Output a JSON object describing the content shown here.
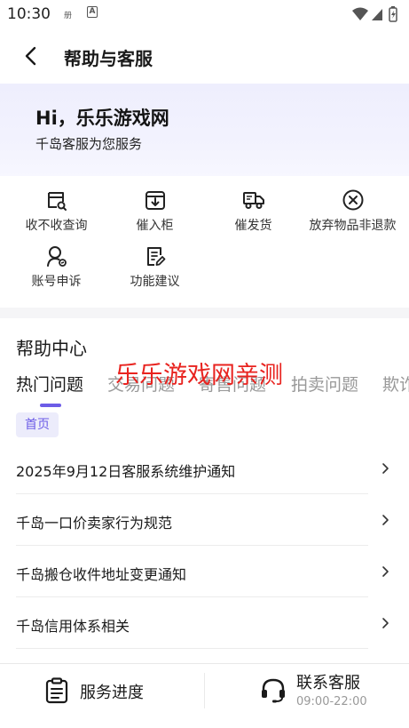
{
  "status_bar": {
    "time": "10:30",
    "notif_1": "册",
    "notif_2": "A"
  },
  "header": {
    "title": "帮助与客服"
  },
  "hero": {
    "greeting": "Hi，乐乐游戏网",
    "subtitle": "千岛客服为您服务"
  },
  "quick_actions": [
    {
      "label": "收不收查询",
      "icon": "receipt-search-icon"
    },
    {
      "label": "催入柜",
      "icon": "cabinet-in-icon"
    },
    {
      "label": "催发货",
      "icon": "delivery-truck-icon"
    },
    {
      "label": "放弃物品非退款",
      "icon": "cancel-circle-icon"
    },
    {
      "label": "账号申诉",
      "icon": "user-appeal-icon"
    },
    {
      "label": "功能建议",
      "icon": "suggestion-edit-icon"
    }
  ],
  "help_center": {
    "title": "帮助中心",
    "tabs": [
      "热门问题",
      "交易问题",
      "寄售问题",
      "拍卖问题",
      "欺诈"
    ],
    "active_tab": 0,
    "chip": "首页",
    "faqs": [
      "2025年9月12日客服系统维护通知",
      "千岛一口价卖家行为规范",
      "千岛搬仓收件地址变更通知",
      "千岛信用体系相关"
    ]
  },
  "watermark": "乐乐游戏网亲测",
  "bottom_bar": {
    "progress_label": "服务进度",
    "contact_label": "联系客服",
    "contact_hours": "09:00-22:00"
  },
  "colors": {
    "accent": "#6c5ce7",
    "watermark": "#e8231f",
    "hero_bg": "#eeeefd"
  }
}
